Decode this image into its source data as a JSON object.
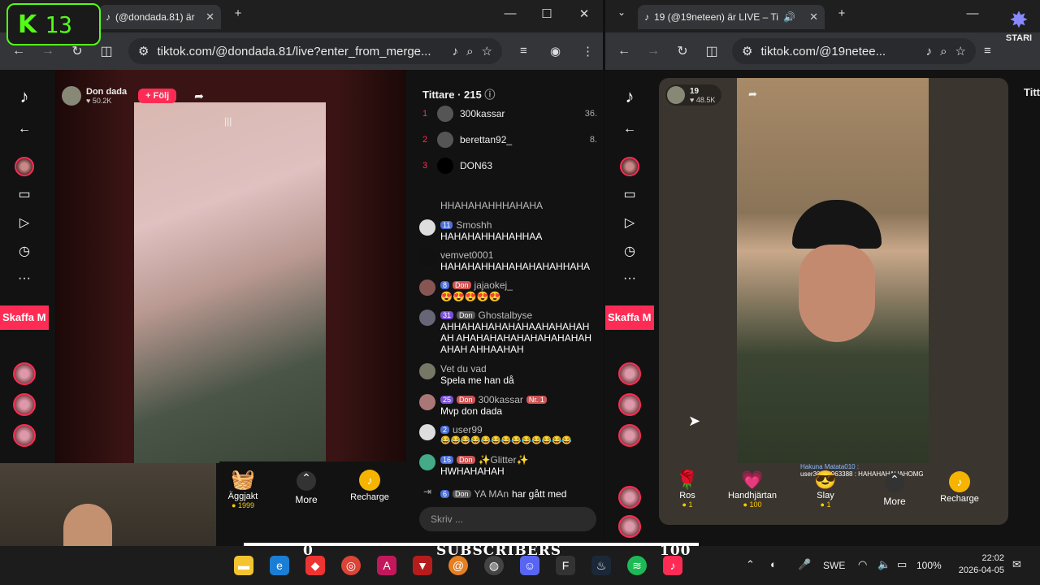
{
  "left_window": {
    "tab_title": "(@dondada.81) är",
    "url": "tiktok.com/@dondada.81/live?enter_from_merge...",
    "streamer": {
      "name": "Don dada",
      "likes": "50.2K",
      "follow_label": "+ Följ"
    },
    "viewers_label": "Tittare · 215",
    "ranking": [
      {
        "rank": "1",
        "name": "300kassar",
        "value": "36."
      },
      {
        "rank": "2",
        "name": "berettan92_",
        "value": "8."
      },
      {
        "rank": "3",
        "name": "DON63",
        "value": ""
      }
    ],
    "chat": [
      {
        "user": "",
        "badges": [],
        "text": "HHAHAHAHHHAHAHA"
      },
      {
        "user": "Smoshh",
        "badges": [
          "11"
        ],
        "text": "HAHAHAHHAHAHHAA"
      },
      {
        "user": "vemvet0001",
        "badges": [],
        "text": "HAHAHAHHAHAHAHAHAHHAHA"
      },
      {
        "user": "jajaokej_",
        "badges": [
          "8",
          "Don"
        ],
        "text": "😍😍😍😍😍"
      },
      {
        "user": "Ghostalbyse",
        "badges": [
          "31",
          "Don"
        ],
        "text": "AHHAHAHAHAHAHAAHAHAHAHAH AHAHAHAHAHAHAHAHAHAHAHAH AHHAAHAH"
      },
      {
        "user": "Vet du vad",
        "badges": [],
        "text": "Spela me han då"
      },
      {
        "user": "300kassar",
        "badges": [
          "25",
          "Don",
          "Nr. 1"
        ],
        "text": "Mvp don dada"
      },
      {
        "user": "user99",
        "badges": [
          "2"
        ],
        "text": "😂😂😂😂😂😂😂😂😂😂😂😂😂"
      },
      {
        "user": "✨Glitter✨",
        "badges": [
          "16",
          "Don"
        ],
        "text": "HWHAHAHAH"
      },
      {
        "user": "YA MAn",
        "badges": [
          "6",
          "Don"
        ],
        "text": "har gått med"
      }
    ],
    "gifts": [
      {
        "name": "Äggjakt",
        "price": "1999"
      },
      {
        "name": "More",
        "price": ""
      },
      {
        "name": "Recharge",
        "price": ""
      }
    ],
    "skaffa": "Skaffa M",
    "input_placeholder": "Skriv ..."
  },
  "right_window": {
    "tab_title": "19 (@19neteen) är LIVE – Ti",
    "url": "tiktok.com/@19netee...",
    "streamer": {
      "name": "19",
      "likes": "48.5K"
    },
    "viewers_label": "Titt",
    "overlay_users": [
      "Hakuna Matata010 :",
      "user30566963388 : HAHAHAHAHAHOMG"
    ],
    "gifts": [
      {
        "name": "Ros",
        "price": "1"
      },
      {
        "name": "Handhjärtan",
        "price": "100"
      },
      {
        "name": "Slay",
        "price": "1"
      },
      {
        "name": "More",
        "price": ""
      },
      {
        "name": "Recharge",
        "price": ""
      }
    ],
    "skaffa": "Skaffa M"
  },
  "overlay": {
    "k_counter": "13",
    "sub_left": "0",
    "sub_label": "SUBSCRIBERS",
    "sub_right": "100",
    "stari": "STARI"
  },
  "taskbar": {
    "lang": "SWE",
    "battery": "100%",
    "time": "22:02",
    "date": "2026-04-05"
  },
  "colors": {
    "tiktok_red": "#fe2c55",
    "kick_green": "#53fc18"
  }
}
